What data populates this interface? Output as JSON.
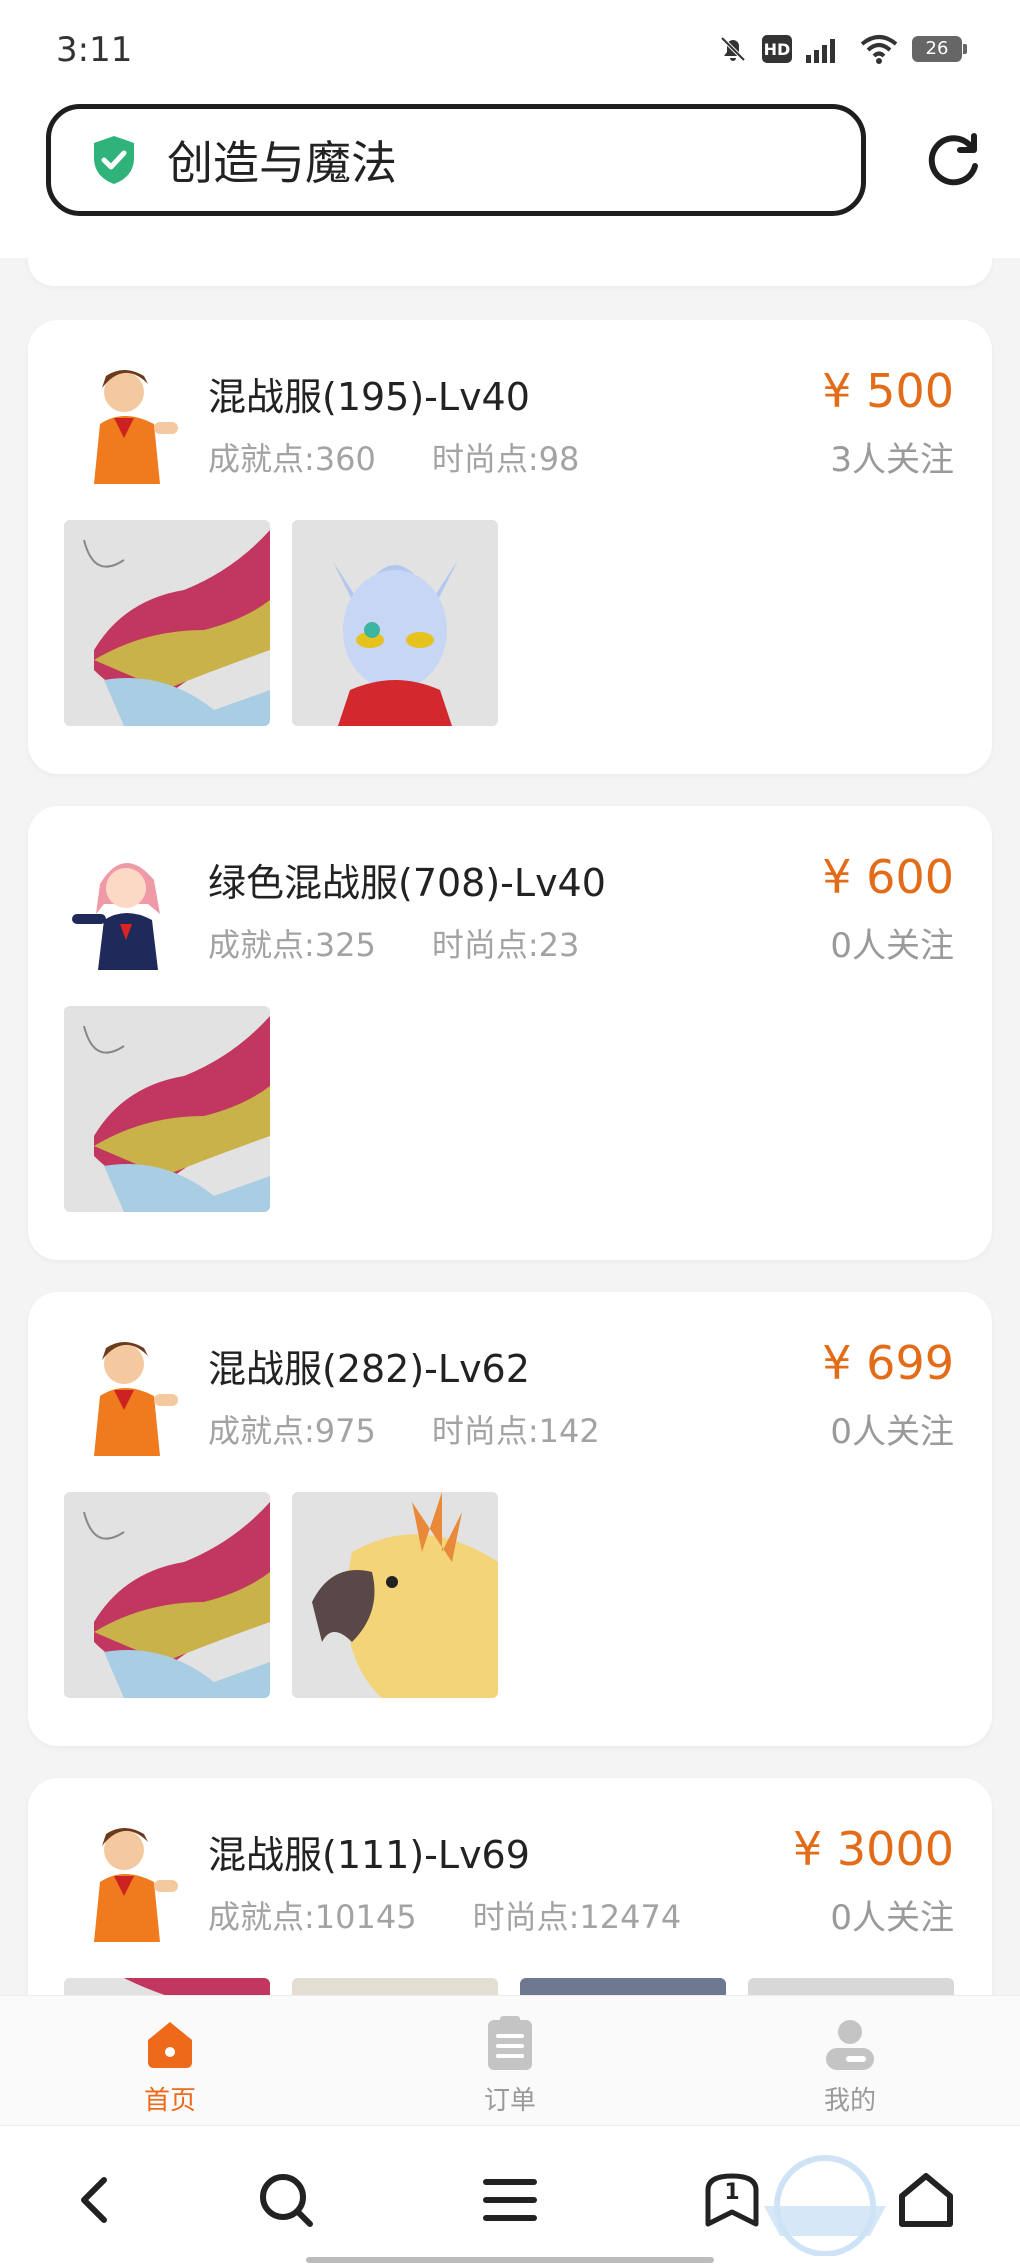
{
  "status_bar": {
    "time": "3:11",
    "battery": "26",
    "hd": "HD"
  },
  "header": {
    "search_text": "创造与魔法"
  },
  "items": [
    {
      "name": "混战服(195)-Lv40",
      "achievement": "成就点:360",
      "fashion": "时尚点:98",
      "price": "¥ 500",
      "followers": "3人关注",
      "avatar": "boy-avatar",
      "thumbs": [
        "dragon-mount",
        "ultraman-mount"
      ]
    },
    {
      "name": "绿色混战服(708)-Lv40",
      "achievement": "成就点:325",
      "fashion": "时尚点:23",
      "price": "¥ 600",
      "followers": "0人关注",
      "avatar": "girl-avatar",
      "thumbs": [
        "dragon-mount"
      ]
    },
    {
      "name": "混战服(282)-Lv62",
      "achievement": "成就点:975",
      "fashion": "时尚点:142",
      "price": "¥ 699",
      "followers": "0人关注",
      "avatar": "boy-avatar",
      "thumbs": [
        "dragon-mount",
        "parrot-mount"
      ]
    },
    {
      "name": "混战服(111)-Lv69",
      "achievement": "成就点:10145",
      "fashion": "时尚点:12474",
      "price": "¥ 3000",
      "followers": "0人关注",
      "avatar": "boy-avatar",
      "thumbs": [
        "dragon-mount",
        "mount-2",
        "mount-3",
        "mount-4"
      ]
    }
  ],
  "tabs": [
    {
      "label": "首页",
      "icon": "home-icon",
      "active": true
    },
    {
      "label": "订单",
      "icon": "clipboard-icon",
      "active": false
    },
    {
      "label": "我的",
      "icon": "user-icon",
      "active": false
    }
  ],
  "colors": {
    "accent": "#ee6a1a",
    "price": "#e36c18",
    "shield": "#2fb37a"
  },
  "nav_buttons": [
    "back-icon",
    "search-icon",
    "menu-icon",
    "tabs-icon",
    "home-icon"
  ],
  "nav_tabs_count": "1"
}
